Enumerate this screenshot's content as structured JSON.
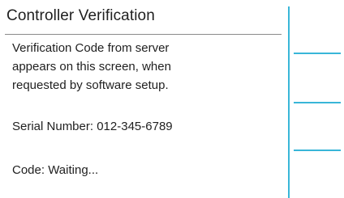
{
  "title": "Controller Verification",
  "message_lines": [
    "Verification Code from server",
    "appears on this screen, when",
    "requested by software setup."
  ],
  "serial": {
    "label": "Serial Number:",
    "value": "012-345-6789"
  },
  "code": {
    "label": "Code:",
    "value": "Waiting..."
  },
  "colors": {
    "accent": "#39b6d8"
  },
  "softkeys": [
    {
      "name": "softkey-1",
      "label": ""
    },
    {
      "name": "softkey-2",
      "label": ""
    },
    {
      "name": "softkey-3",
      "label": ""
    }
  ]
}
